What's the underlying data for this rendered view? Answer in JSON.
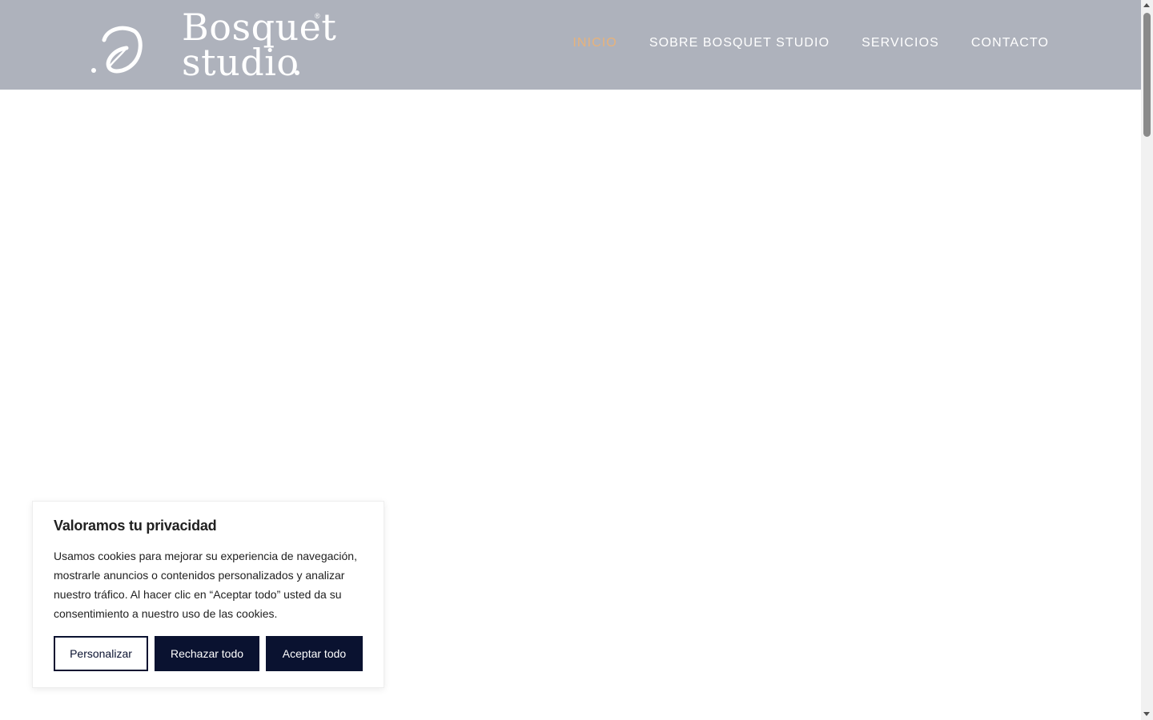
{
  "brand": {
    "line1": "Bosquet",
    "line2": "studio",
    "registered_mark": "®",
    "logo_icon": "leaf-swirl-icon"
  },
  "nav": {
    "items": [
      {
        "label": "INICIO",
        "active": true
      },
      {
        "label": "SOBRE BOSQUET STUDIO",
        "active": false
      },
      {
        "label": "SERVICIOS",
        "active": false
      },
      {
        "label": "CONTACTO",
        "active": false
      }
    ]
  },
  "cookie_banner": {
    "title": "Valoramos tu privacidad",
    "body": "Usamos cookies para mejorar su experiencia de navegación, mostrarle anuncios o contenidos personalizados y analizar nuestro tráfico. Al hacer clic en “Aceptar todo” usted da su consentimiento a nuestro uso de las cookies.",
    "customize_label": "Personalizar",
    "reject_label": "Rechazar todo",
    "accept_label": "Aceptar todo"
  },
  "colors": {
    "header_bg": "#aeb2bc",
    "nav_text": "#ffffff",
    "nav_active": "#e8b27a",
    "button_dark": "#0a1230",
    "banner_text": "#212121"
  }
}
